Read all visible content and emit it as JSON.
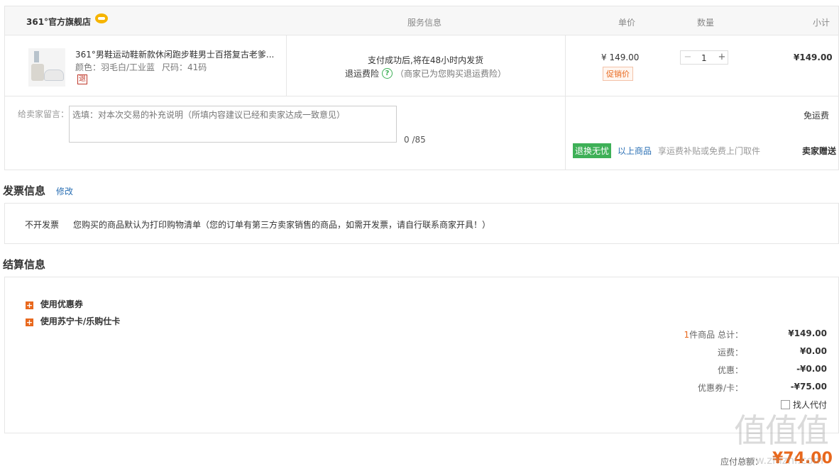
{
  "header": {
    "store_name": "361°官方旗舰店",
    "service_col": "服务信息",
    "unit_price_col": "单价",
    "qty_col": "数量",
    "subtotal_col": "小计"
  },
  "product": {
    "title": "361°男鞋运动鞋新款休闲跑步鞋男士百搭复古老爹...",
    "color_label": "颜色：羽毛白/工业蓝",
    "size_label": "尺码：41码",
    "return_badge": "退",
    "shipping_note": "支付成功后,将在48小时内发货",
    "return_insurance": "退运费险",
    "return_insurance_note": "（商家已为您购买退运费险）",
    "unit_price": "¥ 149.00",
    "promo_tag": "促销价",
    "quantity": "1",
    "subtotal": "¥149.00"
  },
  "message": {
    "label": "给卖家留言：",
    "placeholder": "选填：对本次交易的补充说明（所填内容建议已经和卖家达成一致意见）",
    "counter": "0 /85"
  },
  "shipping_panel": {
    "free_shipping": "免运费",
    "worry_free_badge": "退换无忧",
    "above_goods": "以上商品",
    "enjoy_text": "享运费补贴或免费上门取件",
    "gift": "卖家赠送"
  },
  "invoice": {
    "heading": "发票信息",
    "edit_link": "修改",
    "type": "不开发票",
    "note": "您购买的商品默认为打印购物清单（您的订单有第三方卖家销售的商品，如需开发票，请自行联系商家开具！）"
  },
  "settlement": {
    "heading": "结算信息",
    "coupon_toggle": "使用优惠券",
    "card_toggle": "使用苏宁卡/乐购仕卡",
    "count_prefix": "1",
    "count_label": "件商品 总计：",
    "total": "¥149.00",
    "freight_label": "运费：",
    "freight": "¥0.00",
    "discount_label": "优惠：",
    "discount": "-¥0.00",
    "coupon_label": "优惠券/卡：",
    "coupon": "-¥75.00",
    "pay_for_me": "找人代付",
    "payable_label": "应付总额：",
    "payable": "¥74.00"
  },
  "watermark": {
    "glyphs": "值值值",
    "domain": "www.zhizhi.com"
  },
  "colors": {
    "accent_orange": "#e8681d",
    "link_blue": "#2a6fb4",
    "green_badge": "#3eb057",
    "price_red": "#e4393c"
  }
}
